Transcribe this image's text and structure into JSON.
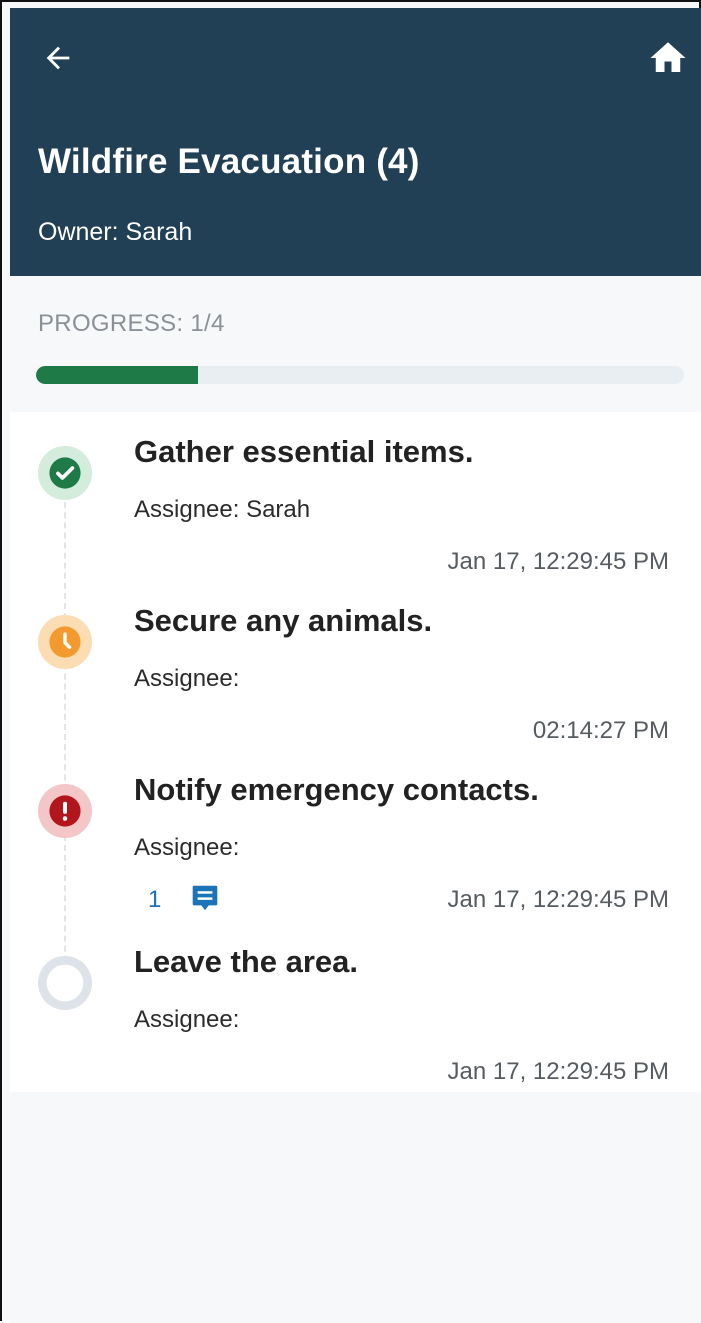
{
  "header": {
    "title": "Wildfire Evacuation (4)",
    "owner": "Owner: Sarah",
    "back_icon": "arrow-left-icon",
    "home_icon": "home-icon",
    "background": "#213f55"
  },
  "progress": {
    "label": "PROGRESS: 1/4",
    "completed": 1,
    "total": 4,
    "fill_color": "#1e7a47"
  },
  "tasks": [
    {
      "title": "Gather essential items.",
      "assignee": "Assignee: Sarah",
      "time": "Jan 17, 12:29:45 PM",
      "status": "done",
      "icon": "check-circle-icon",
      "color": "#1e7a47"
    },
    {
      "title": "Secure any animals.",
      "assignee": "Assignee:",
      "time": "02:14:27 PM",
      "status": "in-progress",
      "icon": "clock-icon",
      "color": "#f29a2e"
    },
    {
      "title": "Notify emergency contacts.",
      "assignee": "Assignee:",
      "time": "Jan 17, 12:29:45 PM",
      "status": "blocked",
      "icon": "alert-icon",
      "color": "#b3151d",
      "comments": "1",
      "comment_icon": "comment-icon"
    },
    {
      "title": "Leave the area.",
      "assignee": "Assignee:",
      "time": "Jan 17, 12:29:45 PM",
      "status": "pending",
      "icon": "empty-circle-icon",
      "color": "#dde3e8"
    }
  ]
}
